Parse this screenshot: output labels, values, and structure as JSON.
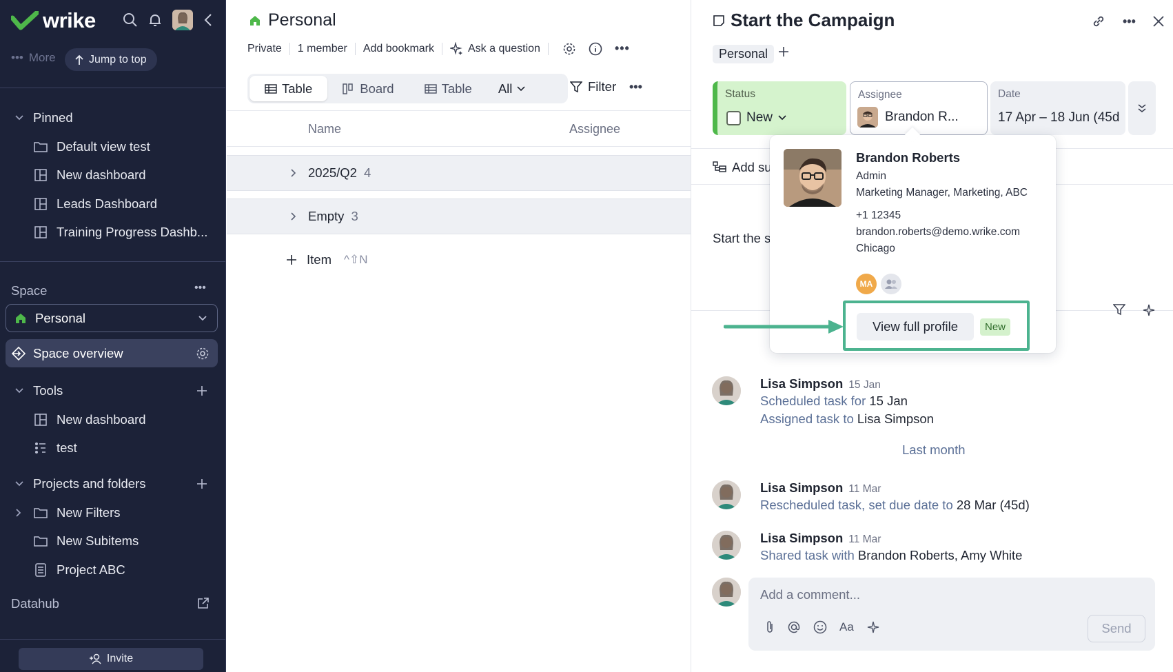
{
  "sidebar": {
    "logo_text": "wrike",
    "more_label": "More",
    "jump_to_top": "Jump to top",
    "pinned": {
      "label": "Pinned",
      "items": [
        {
          "label": "Default view test",
          "icon": "folder-icon"
        },
        {
          "label": "New dashboard",
          "icon": "dashboard-icon"
        },
        {
          "label": "Leads Dashboard",
          "icon": "dashboard-icon"
        },
        {
          "label": "Training Progress Dashb...",
          "icon": "dashboard-icon"
        }
      ]
    },
    "space_label": "Space",
    "space_selected": "Personal",
    "space_overview": "Space overview",
    "tools": {
      "label": "Tools",
      "items": [
        {
          "label": "New dashboard",
          "icon": "dashboard-icon"
        },
        {
          "label": "test",
          "icon": "workflow-icon"
        }
      ]
    },
    "projects": {
      "label": "Projects and folders",
      "items": [
        {
          "label": "New Filters",
          "icon": "folder-icon"
        },
        {
          "label": "New Subitems",
          "icon": "folder-icon"
        },
        {
          "label": "Project ABC",
          "icon": "project-icon"
        }
      ]
    },
    "datahub": "Datahub",
    "invite": "Invite"
  },
  "middle": {
    "title": "Personal",
    "meta": {
      "privacy": "Private",
      "members": "1 member",
      "bookmark": "Add bookmark",
      "ask": "Ask a question"
    },
    "tabs": [
      {
        "label": "Table",
        "active": true
      },
      {
        "label": "Board",
        "active": false
      },
      {
        "label": "Table",
        "active": false
      }
    ],
    "all_label": "All",
    "filter_label": "Filter",
    "columns": {
      "name": "Name",
      "assignee": "Assignee"
    },
    "groups": [
      {
        "name": "2025/Q2",
        "count": "4"
      },
      {
        "name": "Empty",
        "count": "3"
      }
    ],
    "add_item": "Item",
    "add_item_shortcut": "^⇧N"
  },
  "task": {
    "title": "Start the Campaign",
    "chip": "Personal",
    "status": {
      "label": "Status",
      "value": "New"
    },
    "assignee": {
      "label": "Assignee",
      "value": "Brandon R..."
    },
    "date": {
      "label": "Date",
      "value": "17 Apr – 18 Jun (45d"
    },
    "add_subitem": "Add su",
    "description": "Start the s",
    "activity": [
      {
        "who": "Lisa Simpson",
        "when": "15 Jan",
        "lines": [
          {
            "pre": "Scheduled task for ",
            "em": "15 Jan"
          },
          {
            "pre": "Assigned task to ",
            "em": "Lisa Simpson"
          }
        ]
      },
      {
        "who": "Lisa Simpson",
        "when": "11 Mar",
        "lines": [
          {
            "pre": "Rescheduled task, set due date to ",
            "em": "28 Mar (45d)"
          }
        ]
      },
      {
        "who": "Lisa Simpson",
        "when": "11 Mar",
        "lines": [
          {
            "pre": "Shared task with ",
            "em": "Brandon Roberts, Amy White"
          }
        ]
      }
    ],
    "period_divider": "Last month",
    "comment_placeholder": "Add a comment...",
    "send_label": "Send"
  },
  "profile_popover": {
    "name": "Brandon Roberts",
    "role": "Admin",
    "title": "Marketing Manager, Marketing, ABC",
    "phone": "+1 12345",
    "email": "brandon.roberts@demo.wrike.com",
    "city": "Chicago",
    "initials": "MA",
    "view_full_profile": "View full profile",
    "new_badge": "New"
  },
  "colors": {
    "sidebar_bg": "#1c2238",
    "brand_green": "#4eb84a",
    "status_bg": "#d5f3cd",
    "highlight": "#4cb38f",
    "activity_text": "#5a6f96"
  }
}
